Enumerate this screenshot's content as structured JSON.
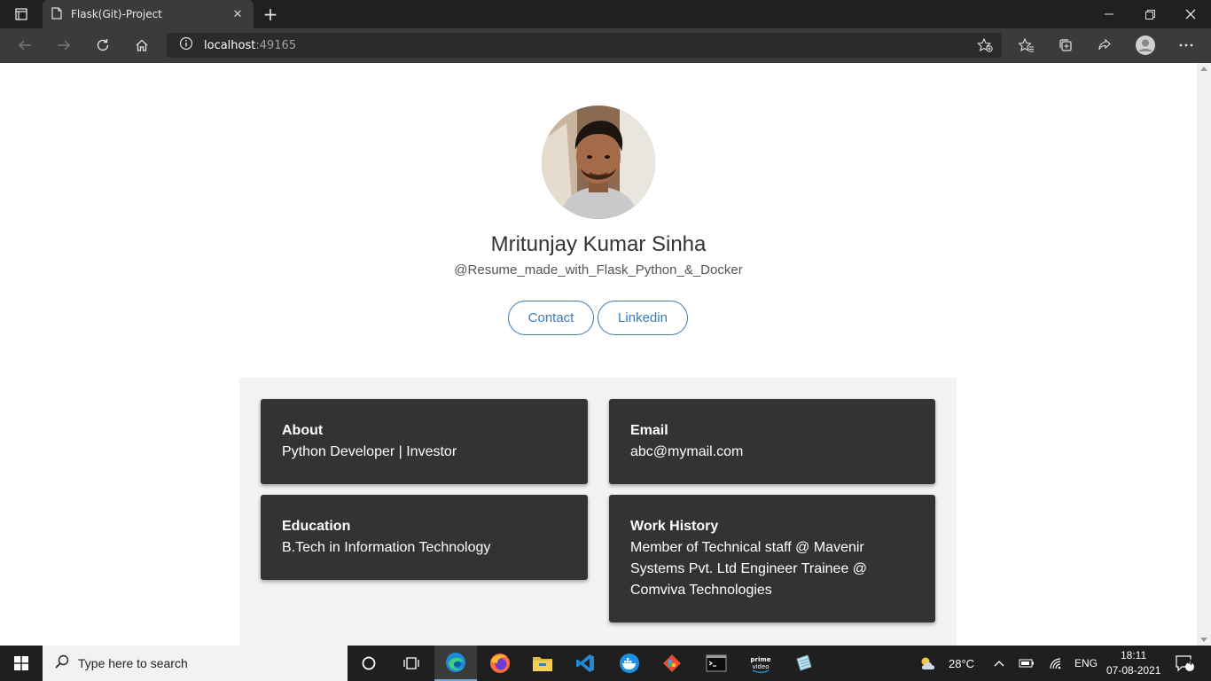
{
  "browser": {
    "tab_title": "Flask(Git)-Project",
    "url_host": "localhost",
    "url_port": ":49165"
  },
  "profile": {
    "name": "Mritunjay Kumar Sinha",
    "subtitle": "@Resume_made_with_Flask_Python_&_Docker",
    "buttons": [
      {
        "label": "Contact"
      },
      {
        "label": "Linkedin"
      }
    ]
  },
  "cards": {
    "about": {
      "title": "About",
      "body": "Python Developer | Investor"
    },
    "email": {
      "title": "Email",
      "body": "abc@mymail.com"
    },
    "education": {
      "title": "Education",
      "body": "B.Tech in Information Technology"
    },
    "work": {
      "title": "Work History",
      "body": "Member of Technical staff @ Mavenir Systems Pvt. Ltd Engineer Trainee @ Comviva Technologies"
    }
  },
  "taskbar": {
    "search_placeholder": "Type here to search",
    "apps": [
      "cortana-icon",
      "task-view-icon",
      "edge-icon",
      "firefox-icon",
      "file-explorer-icon",
      "vscode-icon",
      "docker-icon",
      "git-icon",
      "terminal-icon",
      "prime-video-icon",
      "notepad-icon"
    ],
    "prime_label": "prime video",
    "temperature": "28°C",
    "language": "ENG",
    "time": "18:11",
    "date": "07-08-2021",
    "notification_count": "4"
  },
  "colors": {
    "accent": "#3b7ab8",
    "card_bg": "#333333",
    "panel_bg": "#f3f3f3"
  }
}
